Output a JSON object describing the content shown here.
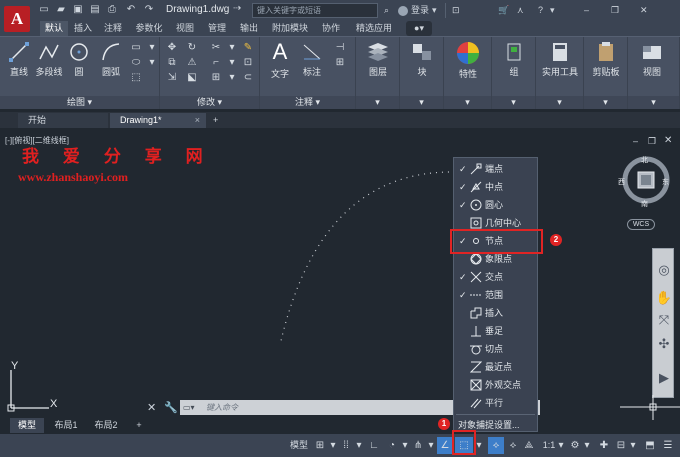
{
  "titlebar": {
    "app_logo": "A",
    "doc_title": "Drawing1.dwg",
    "search_placeholder": "键入关键字或短语",
    "login_label": "登录"
  },
  "ribbon_tabs": [
    "默认",
    "插入",
    "注释",
    "参数化",
    "视图",
    "管理",
    "输出",
    "附加模块",
    "协作",
    "精选应用"
  ],
  "ribbon": {
    "draw_group": {
      "label": "绘图",
      "tools": [
        "直线",
        "多段线",
        "圆",
        "圆弧"
      ]
    },
    "modify_group": {
      "label": "修改"
    },
    "annotation_group": {
      "label": "注释",
      "tools": [
        "文字",
        "标注"
      ]
    },
    "panels": [
      "图层",
      "块",
      "特性",
      "组",
      "实用工具",
      "剪贴板",
      "视图"
    ]
  },
  "file_tabs": {
    "start": "开始",
    "drawing": "Drawing1*"
  },
  "viewport": {
    "label": "[-][俯视][二维线框]",
    "watermark_cn": "我 爱 分 享 网",
    "watermark_url": "www.zhanshaoyi.com"
  },
  "viewcube": {
    "north": "北",
    "south": "南",
    "west": "西",
    "east": "东",
    "wcs": "WCS"
  },
  "ucs": {
    "y": "Y",
    "x": "X"
  },
  "command": {
    "placeholder": "键入命令"
  },
  "layout_tabs": [
    "模型",
    "布局1",
    "布局2"
  ],
  "statusbar": {
    "model_label": "模型",
    "scale_label": "1:1"
  },
  "snap_menu": {
    "items": [
      {
        "label": "端点",
        "checked": true
      },
      {
        "label": "中点",
        "checked": true
      },
      {
        "label": "圆心",
        "checked": true
      },
      {
        "label": "几何中心",
        "checked": false
      },
      {
        "label": "节点",
        "checked": true
      },
      {
        "label": "象限点",
        "checked": false
      },
      {
        "label": "交点",
        "checked": true
      },
      {
        "label": "范围",
        "checked": true
      },
      {
        "label": "插入",
        "checked": false
      },
      {
        "label": "垂足",
        "checked": false
      },
      {
        "label": "切点",
        "checked": false
      },
      {
        "label": "最近点",
        "checked": false
      },
      {
        "label": "外观交点",
        "checked": false
      },
      {
        "label": "平行",
        "checked": false
      }
    ],
    "settings_label": "对象捕捉设置..."
  },
  "callouts": {
    "one": "1",
    "two": "2"
  },
  "colors": {
    "accent_red": "#e02424",
    "active_blue": "#3d7ec9"
  }
}
